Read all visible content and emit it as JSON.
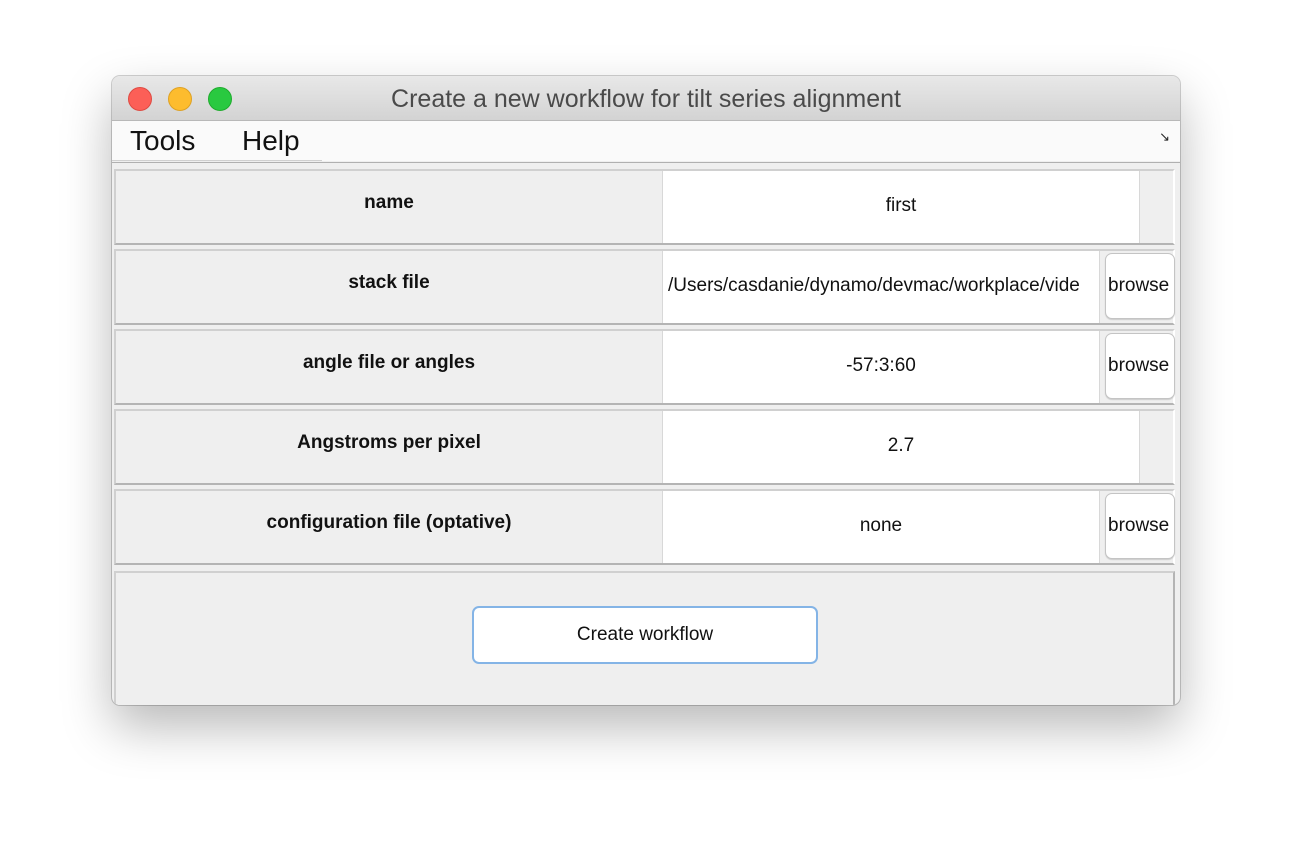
{
  "window": {
    "title": "Create a new workflow for tilt series alignment"
  },
  "menu": {
    "tools": "Tools",
    "help": "Help",
    "resize_icon": "↘"
  },
  "form": {
    "rows": [
      {
        "label": "name",
        "value": "first",
        "button": ""
      },
      {
        "label": "stack file",
        "value": "/Users/casdanie/dynamo/devmac/workplace/vide",
        "button": "browse"
      },
      {
        "label": "angle file or angles",
        "value": "-57:3:60",
        "button": "browse"
      },
      {
        "label": "Angstroms per pixel",
        "value": "2.7",
        "button": ""
      },
      {
        "label": "configuration file (optative)",
        "value": "none",
        "button": "browse"
      }
    ]
  },
  "footer": {
    "create_label": "Create workflow"
  },
  "colors": {
    "close": "#fc5f57",
    "minimize": "#fdbc2e",
    "maximize": "#29c940",
    "focus_ring": "#84b4e6"
  }
}
